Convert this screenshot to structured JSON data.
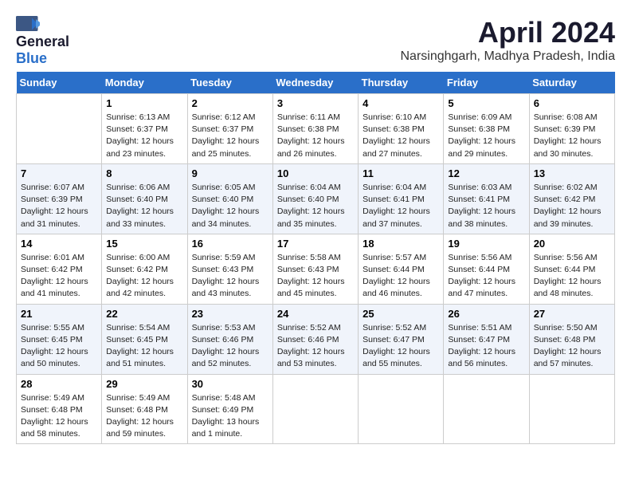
{
  "header": {
    "logo_line1": "General",
    "logo_line2": "Blue",
    "month_title": "April 2024",
    "location": "Narsinghgarh, Madhya Pradesh, India"
  },
  "weekdays": [
    "Sunday",
    "Monday",
    "Tuesday",
    "Wednesday",
    "Thursday",
    "Friday",
    "Saturday"
  ],
  "weeks": [
    [
      {
        "day": "",
        "content": ""
      },
      {
        "day": "1",
        "content": "Sunrise: 6:13 AM\nSunset: 6:37 PM\nDaylight: 12 hours\nand 23 minutes."
      },
      {
        "day": "2",
        "content": "Sunrise: 6:12 AM\nSunset: 6:37 PM\nDaylight: 12 hours\nand 25 minutes."
      },
      {
        "day": "3",
        "content": "Sunrise: 6:11 AM\nSunset: 6:38 PM\nDaylight: 12 hours\nand 26 minutes."
      },
      {
        "day": "4",
        "content": "Sunrise: 6:10 AM\nSunset: 6:38 PM\nDaylight: 12 hours\nand 27 minutes."
      },
      {
        "day": "5",
        "content": "Sunrise: 6:09 AM\nSunset: 6:38 PM\nDaylight: 12 hours\nand 29 minutes."
      },
      {
        "day": "6",
        "content": "Sunrise: 6:08 AM\nSunset: 6:39 PM\nDaylight: 12 hours\nand 30 minutes."
      }
    ],
    [
      {
        "day": "7",
        "content": "Sunrise: 6:07 AM\nSunset: 6:39 PM\nDaylight: 12 hours\nand 31 minutes."
      },
      {
        "day": "8",
        "content": "Sunrise: 6:06 AM\nSunset: 6:40 PM\nDaylight: 12 hours\nand 33 minutes."
      },
      {
        "day": "9",
        "content": "Sunrise: 6:05 AM\nSunset: 6:40 PM\nDaylight: 12 hours\nand 34 minutes."
      },
      {
        "day": "10",
        "content": "Sunrise: 6:04 AM\nSunset: 6:40 PM\nDaylight: 12 hours\nand 35 minutes."
      },
      {
        "day": "11",
        "content": "Sunrise: 6:04 AM\nSunset: 6:41 PM\nDaylight: 12 hours\nand 37 minutes."
      },
      {
        "day": "12",
        "content": "Sunrise: 6:03 AM\nSunset: 6:41 PM\nDaylight: 12 hours\nand 38 minutes."
      },
      {
        "day": "13",
        "content": "Sunrise: 6:02 AM\nSunset: 6:42 PM\nDaylight: 12 hours\nand 39 minutes."
      }
    ],
    [
      {
        "day": "14",
        "content": "Sunrise: 6:01 AM\nSunset: 6:42 PM\nDaylight: 12 hours\nand 41 minutes."
      },
      {
        "day": "15",
        "content": "Sunrise: 6:00 AM\nSunset: 6:42 PM\nDaylight: 12 hours\nand 42 minutes."
      },
      {
        "day": "16",
        "content": "Sunrise: 5:59 AM\nSunset: 6:43 PM\nDaylight: 12 hours\nand 43 minutes."
      },
      {
        "day": "17",
        "content": "Sunrise: 5:58 AM\nSunset: 6:43 PM\nDaylight: 12 hours\nand 45 minutes."
      },
      {
        "day": "18",
        "content": "Sunrise: 5:57 AM\nSunset: 6:44 PM\nDaylight: 12 hours\nand 46 minutes."
      },
      {
        "day": "19",
        "content": "Sunrise: 5:56 AM\nSunset: 6:44 PM\nDaylight: 12 hours\nand 47 minutes."
      },
      {
        "day": "20",
        "content": "Sunrise: 5:56 AM\nSunset: 6:44 PM\nDaylight: 12 hours\nand 48 minutes."
      }
    ],
    [
      {
        "day": "21",
        "content": "Sunrise: 5:55 AM\nSunset: 6:45 PM\nDaylight: 12 hours\nand 50 minutes."
      },
      {
        "day": "22",
        "content": "Sunrise: 5:54 AM\nSunset: 6:45 PM\nDaylight: 12 hours\nand 51 minutes."
      },
      {
        "day": "23",
        "content": "Sunrise: 5:53 AM\nSunset: 6:46 PM\nDaylight: 12 hours\nand 52 minutes."
      },
      {
        "day": "24",
        "content": "Sunrise: 5:52 AM\nSunset: 6:46 PM\nDaylight: 12 hours\nand 53 minutes."
      },
      {
        "day": "25",
        "content": "Sunrise: 5:52 AM\nSunset: 6:47 PM\nDaylight: 12 hours\nand 55 minutes."
      },
      {
        "day": "26",
        "content": "Sunrise: 5:51 AM\nSunset: 6:47 PM\nDaylight: 12 hours\nand 56 minutes."
      },
      {
        "day": "27",
        "content": "Sunrise: 5:50 AM\nSunset: 6:48 PM\nDaylight: 12 hours\nand 57 minutes."
      }
    ],
    [
      {
        "day": "28",
        "content": "Sunrise: 5:49 AM\nSunset: 6:48 PM\nDaylight: 12 hours\nand 58 minutes."
      },
      {
        "day": "29",
        "content": "Sunrise: 5:49 AM\nSunset: 6:48 PM\nDaylight: 12 hours\nand 59 minutes."
      },
      {
        "day": "30",
        "content": "Sunrise: 5:48 AM\nSunset: 6:49 PM\nDaylight: 13 hours\nand 1 minute."
      },
      {
        "day": "",
        "content": ""
      },
      {
        "day": "",
        "content": ""
      },
      {
        "day": "",
        "content": ""
      },
      {
        "day": "",
        "content": ""
      }
    ]
  ]
}
